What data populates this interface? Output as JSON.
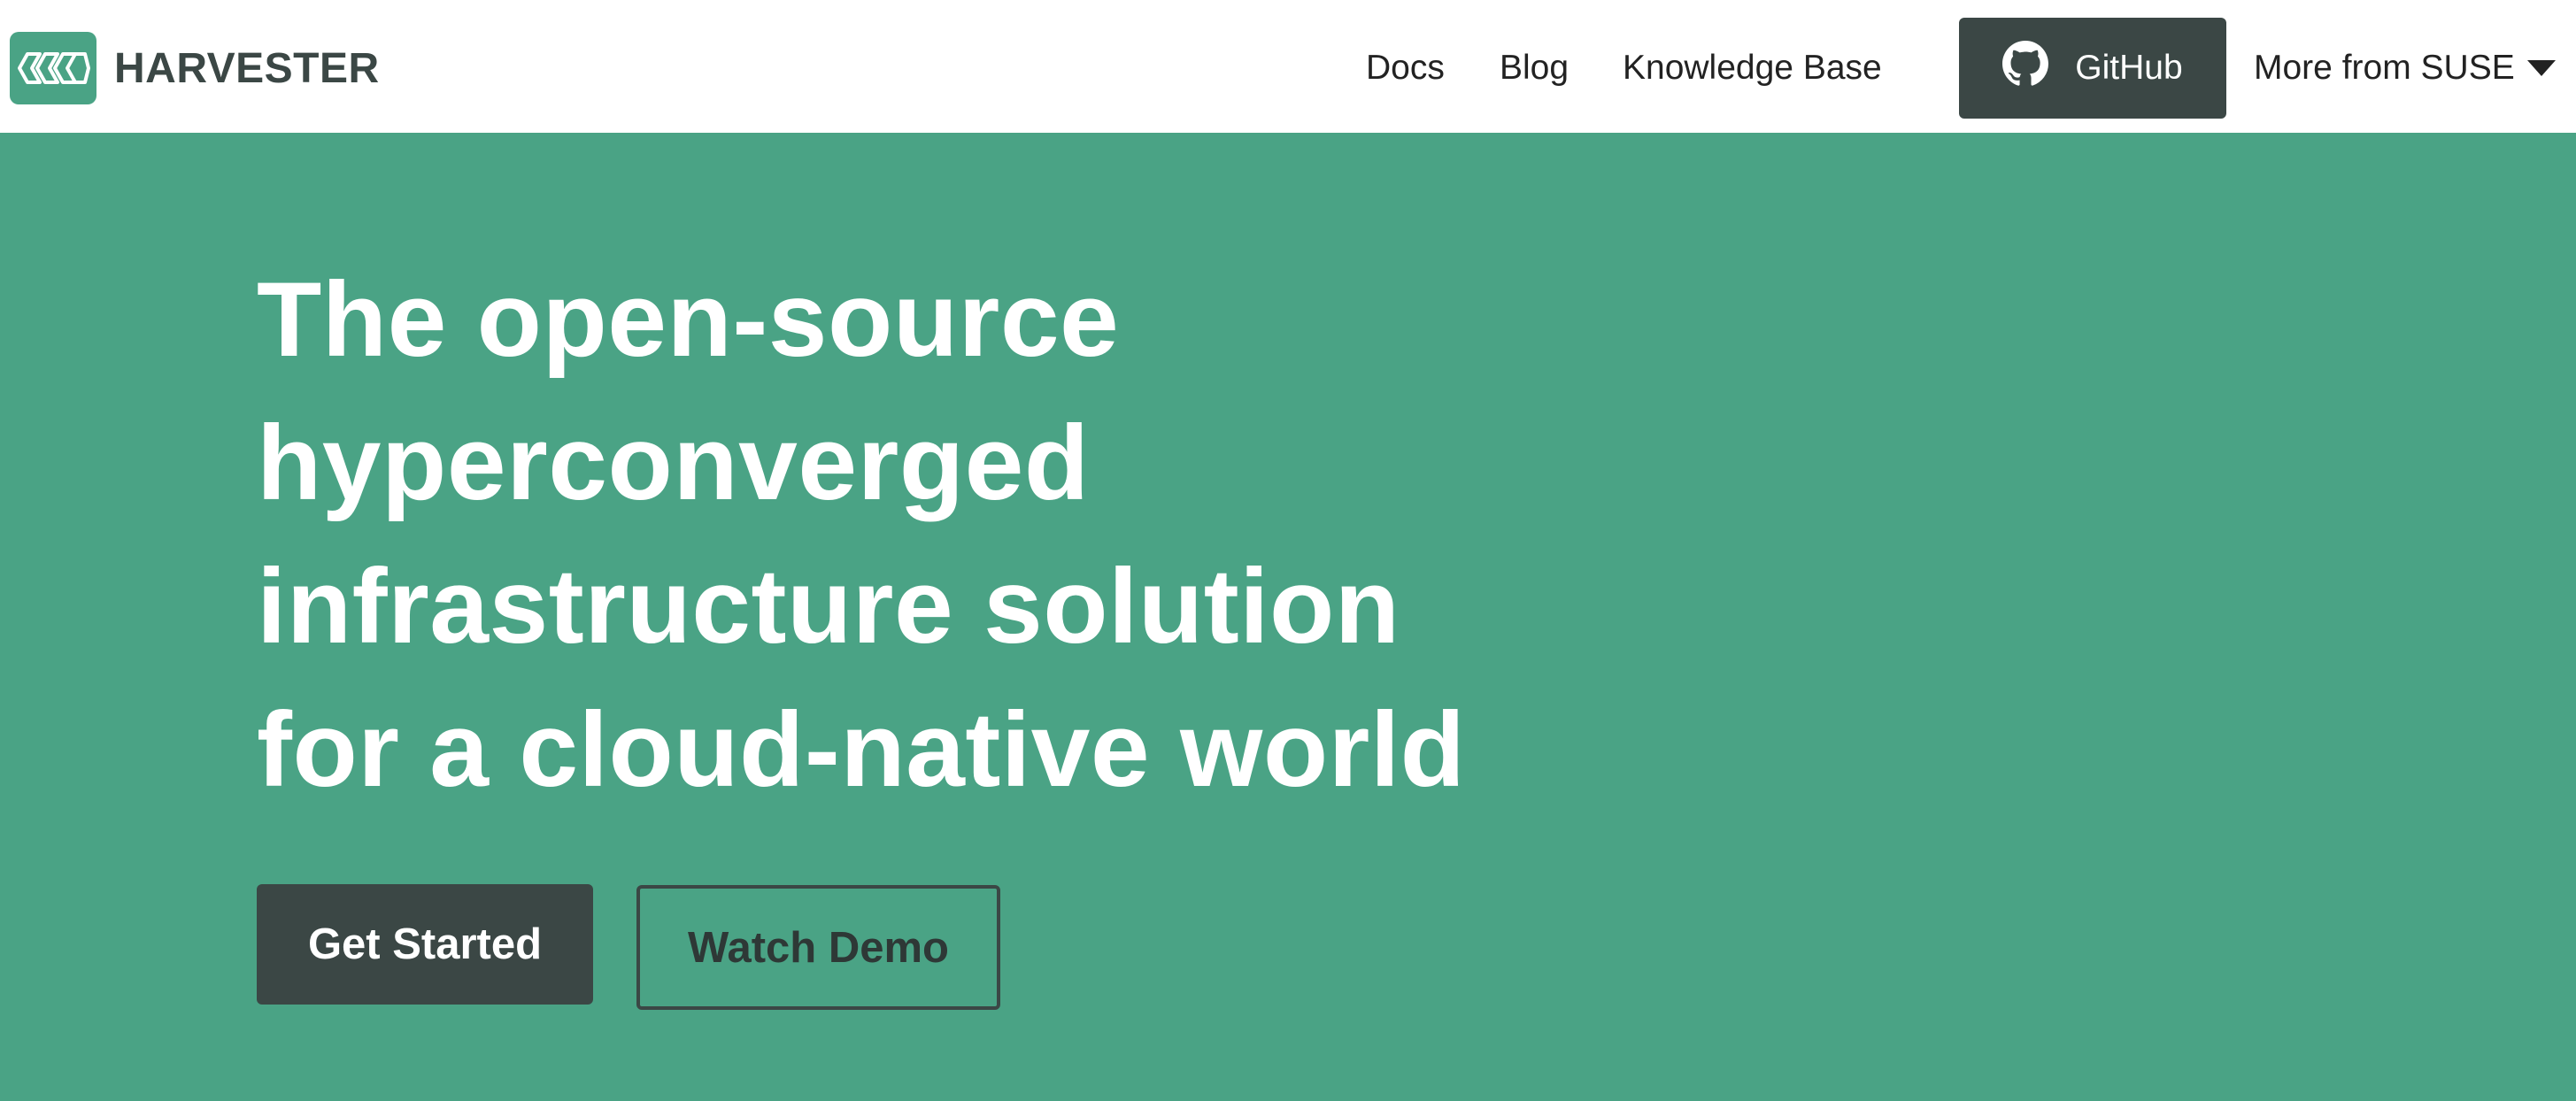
{
  "navbar": {
    "brand_name": "HARVESTER",
    "links": [
      {
        "label": "Docs"
      },
      {
        "label": "Blog"
      },
      {
        "label": "Knowledge Base"
      }
    ],
    "github_label": "GitHub",
    "more_label": "More from SUSE"
  },
  "hero": {
    "title_lines": [
      "The open-source",
      "hyperconverged",
      "infrastructure solution",
      "for a cloud-native world"
    ],
    "primary_button": "Get Started",
    "secondary_button": "Watch Demo"
  },
  "colors": {
    "brand_green": "#4aa385",
    "dark_slate": "#3b4745",
    "white": "#ffffff"
  },
  "icons": {
    "logo": "harvester-logo-icon",
    "github": "github-icon",
    "dropdown": "caret-down-icon"
  }
}
